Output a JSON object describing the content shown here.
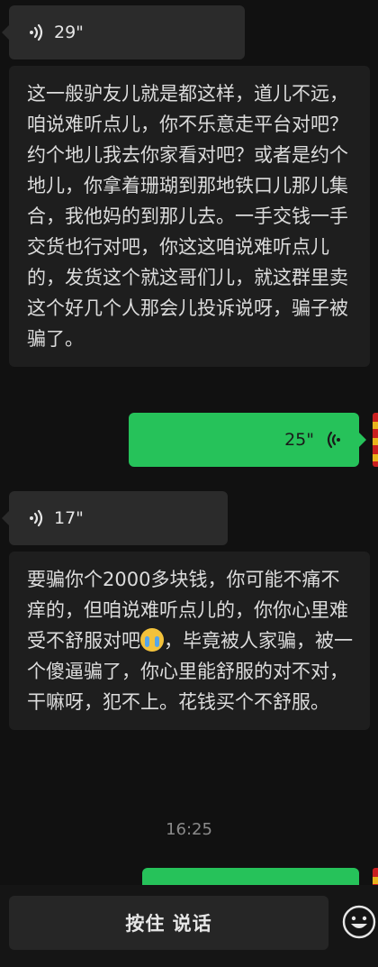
{
  "messages": {
    "voice1": {
      "duration": "29\""
    },
    "transcript1": {
      "text": "这一般驴友儿就是都这样，道儿不远，咱说难听点儿，你不乐意走平台对吧？约个地儿我去你家看对吧？或者是约个地儿，你拿着珊瑚到那地铁口儿那儿集合，我他妈的到那儿去。一手交钱一手交货也行对吧，你这这咱说难听点儿的，发货这个就这哥们儿，就这群里卖这个好几个人那会儿投诉说呀，骗子被骗了。"
    },
    "voice2_out": {
      "duration": "25\""
    },
    "voice3": {
      "duration": "17\""
    },
    "transcript3": {
      "text_before_emoji": "要骗你个2000多块钱，你可能不痛不痒的，但咱说难听点儿的，你你心里难受不舒服对吧",
      "emoji": "loudly-crying-face",
      "text_after_emoji": "，毕竟被人家骗，被一个傻逼骗了，你心里能舒服的对不对，干嘛呀，犯不上。花钱买个不舒服。"
    }
  },
  "timestamp": "16:25",
  "input_bar": {
    "hold_to_talk_label": "按住 说话",
    "emoji_icon": "smiley-icon"
  },
  "colors": {
    "background": "#111111",
    "incoming_bubble": "#2b2b2b",
    "transcript_bg": "#1e1e1e",
    "outgoing_bubble": "#26c25a"
  }
}
